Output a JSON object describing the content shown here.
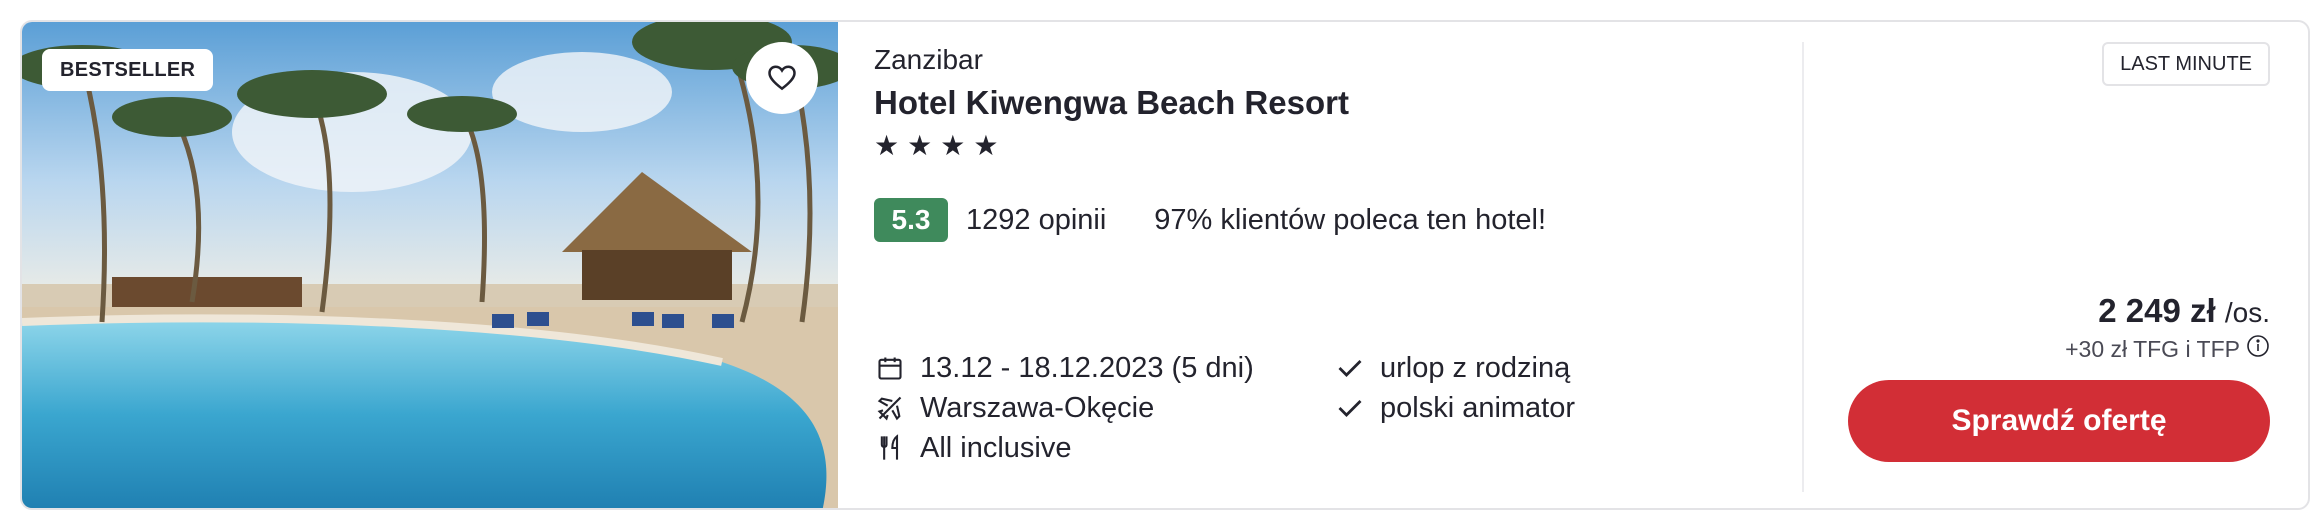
{
  "badges": {
    "bestseller": "BESTSELLER",
    "last_minute": "LAST MINUTE"
  },
  "hotel": {
    "region": "Zanzibar",
    "name": "Hotel Kiwengwa Beach Resort",
    "stars": 4,
    "star_glyph": "★",
    "rating": "5.3",
    "reviews": "1292 opinii",
    "recommend": "97% klientów poleca ten hotel!"
  },
  "details": {
    "dates": "13.12 - 18.12.2023 (5 dni)",
    "departure": "Warszawa-Okęcie",
    "board": "All inclusive"
  },
  "features": [
    "urlop z rodziną",
    "polski animator"
  ],
  "price": {
    "amount": "2 249 zł",
    "per": "/os.",
    "extra": "+30 zł TFG i TFP"
  },
  "cta": {
    "label": "Sprawdź ofertę"
  },
  "icons": {
    "favorite": "heart-outline-icon",
    "dates": "calendar-icon",
    "departure": "plane-icon",
    "board": "cutlery-icon",
    "feature": "check-icon",
    "info": "info-icon"
  },
  "colors": {
    "rating_bg": "#3f8a5c",
    "cta_bg": "#d22e36",
    "text": "#23232d"
  }
}
